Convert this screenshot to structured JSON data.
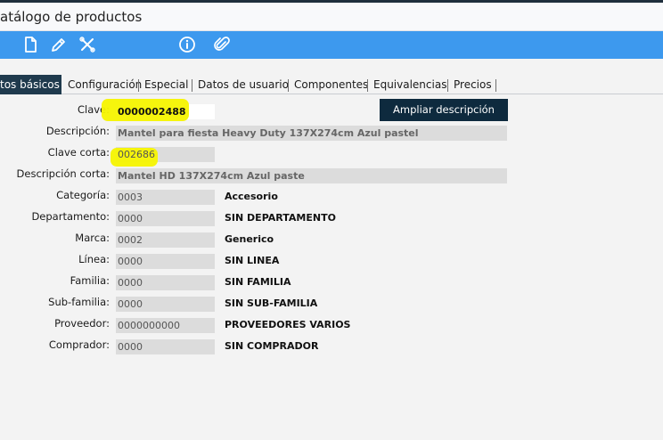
{
  "window": {
    "title": "atálogo de productos"
  },
  "toolbar": {
    "icons": [
      "new-document-icon",
      "edit-pencil-icon",
      "cancel-tools-icon",
      "info-icon",
      "attach-clip-icon"
    ],
    "bar_color": "#3d99ee"
  },
  "tabs": [
    {
      "label": "tos básicos",
      "active": true
    },
    {
      "label": "Configuración"
    },
    {
      "label": "Especial"
    },
    {
      "label": "Datos de usuario"
    },
    {
      "label": "Componentes"
    },
    {
      "label": "Equivalencias"
    },
    {
      "label": "Precios"
    }
  ],
  "form": {
    "expand_button": "Ampliar descripción",
    "highlight_color": "#f6f400",
    "clave": {
      "label": "Clave:",
      "value": "0000002488"
    },
    "descripcion": {
      "label": "Descripción:",
      "value": "Mantel para fiesta Heavy Duty 137X274cm Azul pastel"
    },
    "clave_corta": {
      "label": "Clave corta:",
      "value": "002686"
    },
    "descripcion_corta": {
      "label": "Descripción corta:",
      "value": "Mantel HD 137X274cm Azul paste"
    },
    "rows": [
      {
        "label": "Categoría:",
        "code": "0003",
        "desc": "Accesorio"
      },
      {
        "label": "Departamento:",
        "code": "0000",
        "desc": "SIN DEPARTAMENTO"
      },
      {
        "label": "Marca:",
        "code": "0002",
        "desc": "Generico"
      },
      {
        "label": "Línea:",
        "code": "0000",
        "desc": "SIN LINEA"
      },
      {
        "label": "Familia:",
        "code": "0000",
        "desc": "SIN FAMILIA"
      },
      {
        "label": "Sub-familia:",
        "code": "0000",
        "desc": "SIN SUB-FAMILIA"
      },
      {
        "label": "Proveedor:",
        "code": "0000000000",
        "desc": "PROVEEDORES VARIOS"
      },
      {
        "label": "Comprador:",
        "code": "0000",
        "desc": "SIN COMPRADOR"
      }
    ]
  }
}
